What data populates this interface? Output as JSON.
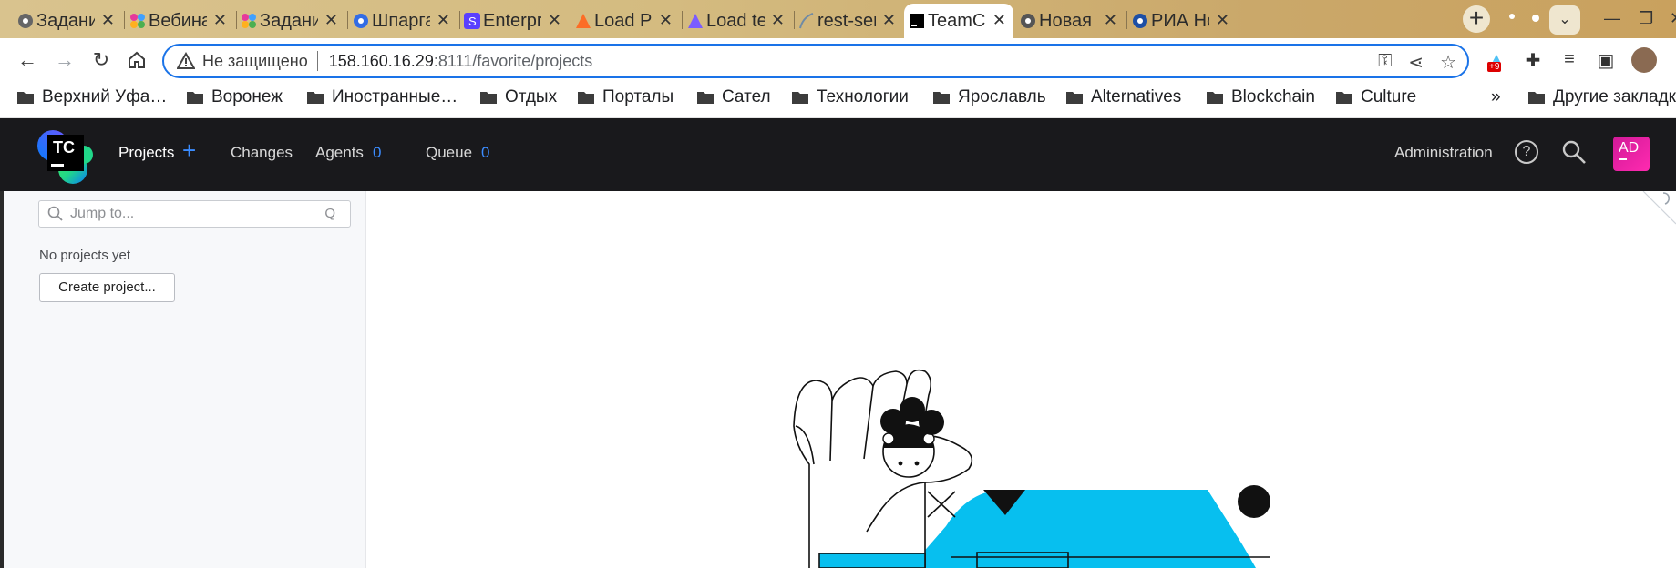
{
  "browser": {
    "tabs": [
      {
        "title": "Задани",
        "favicon": "globe-icon"
      },
      {
        "title": "Вебина",
        "favicon": "colorful-dots-icon"
      },
      {
        "title": "Задани",
        "favicon": "colorful-dots-icon"
      },
      {
        "title": "Шпарга",
        "favicon": "kubernetes-icon"
      },
      {
        "title": "Enterpr",
        "favicon": "s-square-icon"
      },
      {
        "title": "Load Pe",
        "favicon": "gitlab-icon"
      },
      {
        "title": "Load te",
        "favicon": "purple-triangle-icon"
      },
      {
        "title": "rest-ser",
        "favicon": "feather-icon"
      },
      {
        "title": "TeamCi",
        "favicon": "teamcity-icon",
        "active": true
      },
      {
        "title": "Новая",
        "favicon": "chrome-icon"
      },
      {
        "title": "РИА Но",
        "favicon": "ria-icon"
      }
    ],
    "close_glyph": "✕",
    "new_tab_glyph": "+",
    "address": {
      "security_label": "Не защищено",
      "host": "158.160.16.29",
      "path": ":8111/favorite/projects"
    },
    "extension_badge": "+9",
    "bookmarks": [
      "Верхний Уфа…",
      "Воронеж",
      "Иностранные…",
      "Отдых",
      "Порталы",
      "Сател",
      "Технологии",
      "Ярославль",
      "Alternatives",
      "Blockchain",
      "Culture"
    ],
    "bookmarks_overflow": "»",
    "other_bookmarks": "Другие закладк"
  },
  "teamcity": {
    "logo_text": "TC",
    "nav": {
      "projects": "Projects",
      "changes": "Changes",
      "agents": "Agents",
      "agents_count": "0",
      "queue": "Queue",
      "queue_count": "0",
      "administration": "Administration"
    },
    "user_initials": "AD",
    "help_glyph": "?",
    "sidebar": {
      "search_placeholder": "Jump to...",
      "search_shortcut": "Q",
      "empty_text": "No projects yet",
      "create_button": "Create project..."
    }
  },
  "colors": {
    "accent_blue": "#3b8cff",
    "header_bg": "#19191c",
    "illustration_cyan": "#07bfef",
    "avatar_pink": "#e3219c"
  }
}
